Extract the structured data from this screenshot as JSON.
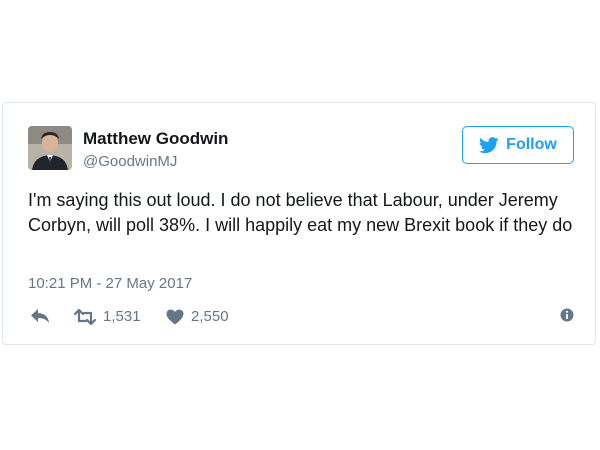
{
  "tweet": {
    "author": {
      "display_name": "Matthew Goodwin",
      "handle": "@GoodwinMJ",
      "avatar_icon": "profile-photo"
    },
    "follow_button": {
      "label": "Follow",
      "icon": "twitter-bird-icon"
    },
    "text": "I'm saying this out loud. I do not believe that Labour, under Jeremy Corbyn, will poll 38%. I will happily eat my new Brexit book if they do",
    "timestamp": "10:21 PM - 27 May 2017",
    "actions": {
      "reply_icon": "reply-icon",
      "retweet_icon": "retweet-icon",
      "retweet_count": "1,531",
      "like_icon": "heart-icon",
      "like_count": "2,550",
      "info_icon": "info-icon"
    }
  },
  "colors": {
    "accent": "#1da1f2",
    "text": "#14171a",
    "muted": "#657786",
    "border": "#e1e8ed"
  }
}
